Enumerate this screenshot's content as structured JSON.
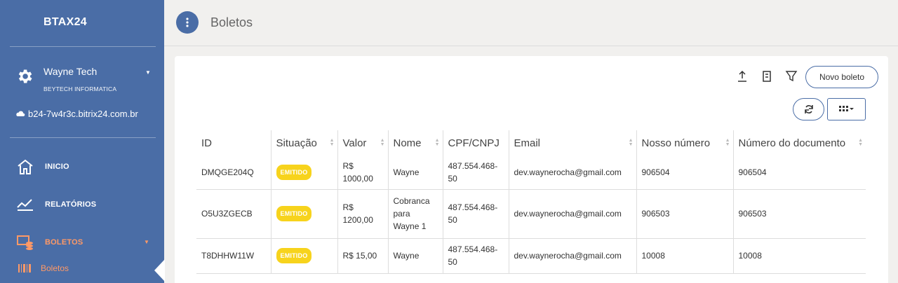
{
  "sidebar": {
    "brand": "BTAX24",
    "company_name": "Wayne Tech",
    "company_sub": "BEYTECH INFORMATICA",
    "domain": "b24-7w4r3c.bitrix24.com.br",
    "nav": [
      {
        "label": "INICIO",
        "icon": "home-icon"
      },
      {
        "label": "RELATÓRIOS",
        "icon": "chart-icon"
      },
      {
        "label": "BOLETOS",
        "icon": "boletos-icon"
      }
    ],
    "sub_item": "Boletos",
    "colors": {
      "bg": "#4a6da6",
      "accent": "#ff9966"
    }
  },
  "header": {
    "title": "Boletos"
  },
  "toolbar": {
    "new_button": "Novo boleto"
  },
  "table": {
    "columns": [
      "ID",
      "Situação",
      "Valor",
      "Nome",
      "CPF/CNPJ",
      "Email",
      "Nosso número",
      "Número do documento"
    ],
    "rows": [
      {
        "id": "DMQGE204Q",
        "status": "EMITIDO",
        "valor": "R$ 1000,00",
        "nome": "Wayne",
        "cpf": "487.554.468-50",
        "email": "dev.waynerocha@gmail.com",
        "nosso": "906504",
        "doc": "906504"
      },
      {
        "id": "O5U3ZGECB",
        "status": "EMITIDO",
        "valor": "R$ 1200,00",
        "nome": "Cobranca para Wayne 1",
        "cpf": "487.554.468-50",
        "email": "dev.waynerocha@gmail.com",
        "nosso": "906503",
        "doc": "906503"
      },
      {
        "id": "T8DHHW11W",
        "status": "EMITIDO",
        "valor": "R$ 15,00",
        "nome": "Wayne",
        "cpf": "487.554.468-50",
        "email": "dev.waynerocha@gmail.com",
        "nosso": "10008",
        "doc": "10008"
      }
    ]
  }
}
